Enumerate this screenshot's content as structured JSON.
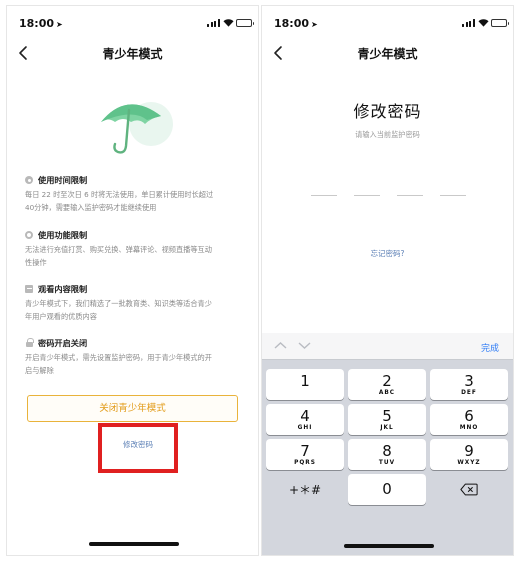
{
  "left_screen": {
    "status": {
      "time": "18:00"
    },
    "title": "青少年模式",
    "sections": [
      {
        "title": "使用时间限制",
        "body": "每日 22 时至次日 6 时将无法使用，单日累计使用时长超过\n40分钟，需要输入监护密码才能继续使用",
        "icon": "clock-icon"
      },
      {
        "title": "使用功能限制",
        "body": "无法进行充值打赏、购买兑换、弹幕评论、视频直播等互动\n性操作",
        "icon": "settings-icon"
      },
      {
        "title": "观看内容限制",
        "body": "青少年模式下，我们精选了一批教育类、知识类等适合青少\n年用户观看的优质内容",
        "icon": "content-icon"
      },
      {
        "title": "密码开启关闭",
        "body": "开启青少年模式，需先设置监护密码，用于青少年模式的开\n启与解除",
        "icon": "lock-icon"
      }
    ],
    "close_button": "关闭青少年模式",
    "change_password_link": "修改密码"
  },
  "right_screen": {
    "status": {
      "time": "18:00"
    },
    "title": "青少年模式",
    "heading": "修改密码",
    "hint": "请输入当前监护密码",
    "forgot_link": "忘记密码?",
    "keyboard": {
      "done": "完成",
      "keys": [
        {
          "num": "1",
          "letters": ""
        },
        {
          "num": "2",
          "letters": "ABC"
        },
        {
          "num": "3",
          "letters": "DEF"
        },
        {
          "num": "4",
          "letters": "GHI"
        },
        {
          "num": "5",
          "letters": "JKL"
        },
        {
          "num": "6",
          "letters": "MNO"
        },
        {
          "num": "7",
          "letters": "PQRS"
        },
        {
          "num": "8",
          "letters": "TUV"
        },
        {
          "num": "9",
          "letters": "WXYZ"
        },
        {
          "num": "+＊#",
          "letters": ""
        },
        {
          "num": "0",
          "letters": ""
        }
      ]
    }
  },
  "colors": {
    "accent_orange": "#e9b33b",
    "link_blue": "#5b7fb5",
    "umbrella_green": "#6fcf97",
    "highlight_red": "#e02020",
    "keyboard_blue": "#2f7cf6"
  }
}
